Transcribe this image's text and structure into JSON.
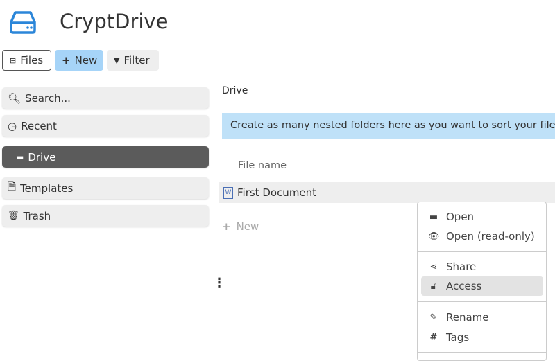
{
  "app": {
    "title": "CryptDrive"
  },
  "toolbar": {
    "files": "Files",
    "new": "New",
    "filter": "Filter"
  },
  "sidebar": {
    "items": [
      {
        "label": "Search..."
      },
      {
        "label": "Recent"
      },
      {
        "label": "Drive"
      },
      {
        "label": "Templates"
      },
      {
        "label": "Trash"
      }
    ]
  },
  "main": {
    "breadcrumb": "Drive",
    "info": "Create as many nested folders here as you want to sort your files.",
    "column_header": "File name",
    "files": [
      {
        "name": "First Document"
      }
    ],
    "new_label": "New"
  },
  "context_menu": {
    "items": [
      {
        "label": "Open"
      },
      {
        "label": "Open (read-only)"
      },
      {
        "label": "Share"
      },
      {
        "label": "Access"
      },
      {
        "label": "Rename"
      },
      {
        "label": "Tags"
      }
    ]
  },
  "colors": {
    "accent": "#2b86d9",
    "new_button": "#a6d4f8",
    "info_banner": "#bfe1f8",
    "active_item": "#5b5b5b"
  }
}
